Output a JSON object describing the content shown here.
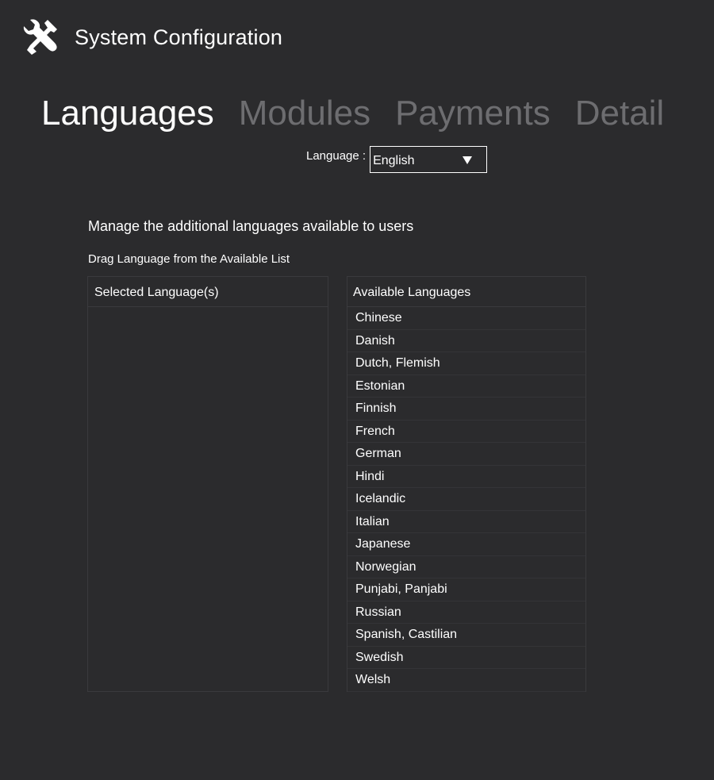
{
  "header": {
    "title": "System Configuration",
    "icon": "tools-icon"
  },
  "tabs": [
    {
      "label": "Languages",
      "active": true
    },
    {
      "label": "Modules",
      "active": false
    },
    {
      "label": "Payments",
      "active": false
    },
    {
      "label": "Detail",
      "active": false
    }
  ],
  "language_select": {
    "label": "Language :",
    "value": "English"
  },
  "manage_text": "Manage the additional languages available to users",
  "drag_text": "Drag Language from the Available List",
  "selected_panel": {
    "header": "Selected Language(s)",
    "items": []
  },
  "available_panel": {
    "header": "Available Languages",
    "items": [
      "Chinese",
      "Danish",
      "Dutch, Flemish",
      "Estonian",
      "Finnish",
      "French",
      "German",
      "Hindi",
      "Icelandic",
      "Italian",
      "Japanese",
      "Norwegian",
      "Punjabi, Panjabi",
      "Russian",
      "Spanish, Castilian",
      "Swedish",
      "Welsh"
    ]
  },
  "colors": {
    "background": "#2b2b2d",
    "active_tab": "#ffffff",
    "inactive_tab": "#6d6d70",
    "border": "#3a3a3d"
  }
}
